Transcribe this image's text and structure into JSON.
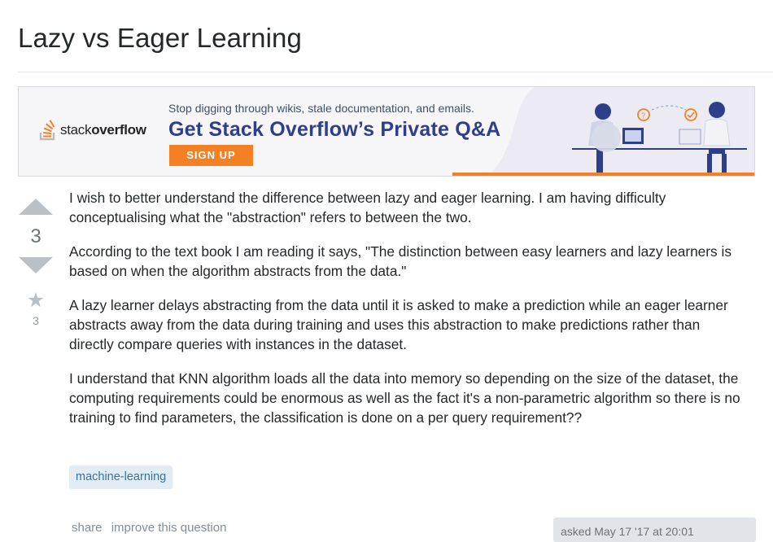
{
  "question": {
    "title": "Lazy vs Eager Learning",
    "votes": "3",
    "favorites": "3",
    "paragraphs": [
      "I wish to better understand the difference between lazy and eager learning. I am having difficulty conceptualising what the \"abstraction\" refers to between the two.",
      "According to the text book I am reading it says, \"The distinction between easy learners and lazy learners is based on when the algorithm abstracts from the data.\"",
      "A lazy learner delays abstracting from the data until it is asked to make a prediction while an eager learner abstracts away from the data during training and uses this abstraction to make predictions rather than directly compare queries with instances in the dataset.",
      "I understand that KNN algorithm loads all the data into memory so depending on the size of the dataset, the computing requirements could be enormous as well as the fact it's a non-parametric algorithm so there is no training to find parameters, the classification is done on a per query requirement??"
    ],
    "tags": [
      "machine-learning"
    ],
    "menu": {
      "share": "share",
      "improve": "improve this question"
    },
    "asked": "asked May 17 '17 at 20:01"
  },
  "ad": {
    "logo_plain": "stack",
    "logo_bold": "overflow",
    "tagline": "Stop digging through wikis, stale documentation, and emails.",
    "headline": "Get Stack Overflow’s Private Q&A",
    "cta": "SIGN UP",
    "colors": {
      "accent": "#f48024",
      "headline": "#2f3e88",
      "background": "#f6f6f9"
    }
  },
  "colors": {
    "tag_bg": "#e1ecf4",
    "tag_text": "#39739d",
    "vote_arrow": "#bbc0c4"
  }
}
